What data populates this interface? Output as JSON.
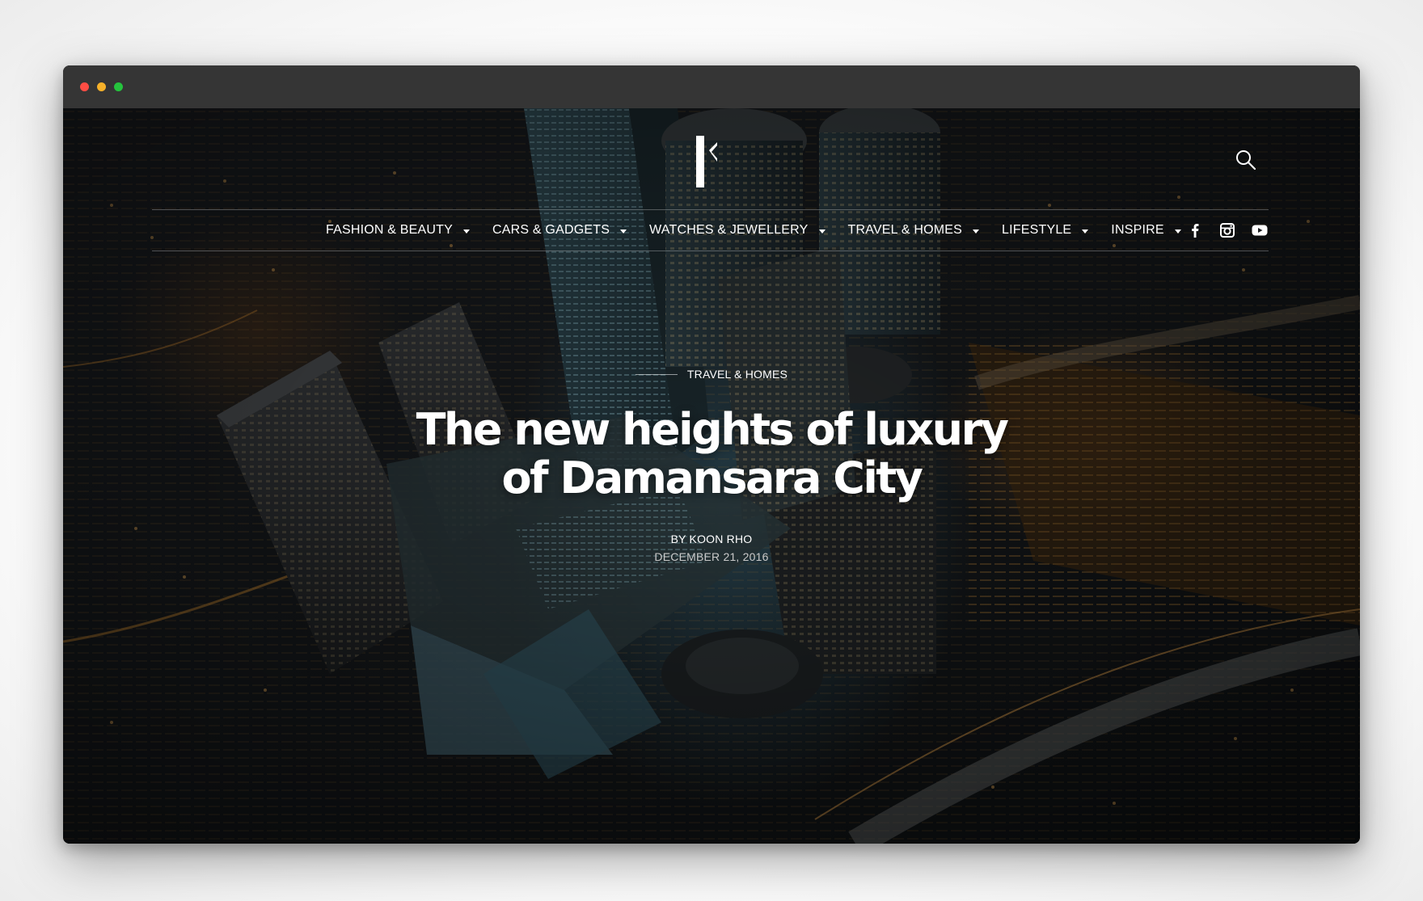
{
  "window": {
    "controls": [
      "close",
      "minimize",
      "zoom"
    ]
  },
  "header": {
    "logo_icon": "brand-logo-icon",
    "search_icon": "search-icon"
  },
  "nav": {
    "items": [
      {
        "label": "FASHION & BEAUTY",
        "has_dropdown": true
      },
      {
        "label": "CARS & GADGETS",
        "has_dropdown": true
      },
      {
        "label": "WATCHES & JEWELLERY",
        "has_dropdown": true
      },
      {
        "label": "TRAVEL & HOMES",
        "has_dropdown": true
      },
      {
        "label": "LIFESTYLE",
        "has_dropdown": true
      },
      {
        "label": "INSPIRE",
        "has_dropdown": true
      }
    ],
    "social": [
      {
        "icon": "facebook-icon"
      },
      {
        "icon": "instagram-icon"
      },
      {
        "icon": "youtube-icon"
      }
    ]
  },
  "article": {
    "category": "TRAVEL & HOMES",
    "title_line1": "The new heights of luxury",
    "title_line2": "of Damansara City",
    "byline": "BY KOON RHO",
    "date": "DECEMBER 21, 2016"
  },
  "colors": {
    "titlebar": "#353535",
    "close": "#ff4d44",
    "minimize": "#f6b12a",
    "zoom": "#25c33d",
    "text": "#ffffff"
  }
}
